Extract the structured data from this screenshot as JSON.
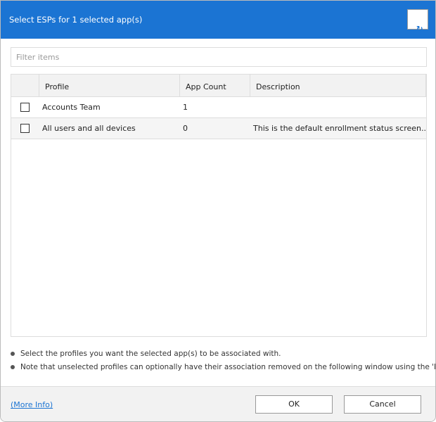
{
  "dialog": {
    "title": "Select ESPs for 1 selected app(s)",
    "refresh_icon": "refresh-icon"
  },
  "filter": {
    "placeholder": "Filter items",
    "value": ""
  },
  "table": {
    "columns": [
      "",
      "Profile",
      "App Count",
      "Description"
    ],
    "rows": [
      {
        "checked": false,
        "profile": "Accounts Team",
        "app_count": "1",
        "description": ""
      },
      {
        "checked": false,
        "profile": "All users and all devices",
        "app_count": "0",
        "description": "This is the default enrollment status screen..."
      }
    ]
  },
  "notes": [
    "Select the profiles you want the selected app(s) to be associated with.",
    "Note that unselected profiles can optionally have their association removed on the following window using the 'Enforce"
  ],
  "footer": {
    "more_info": "(More Info)",
    "ok": "OK",
    "cancel": "Cancel"
  },
  "colors": {
    "accent": "#1b74d3"
  }
}
